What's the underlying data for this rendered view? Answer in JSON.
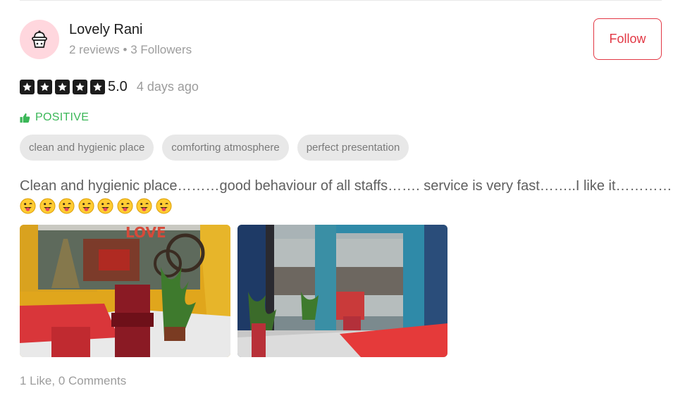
{
  "reviewer": {
    "name": "Lovely Rani",
    "reviews": "2 reviews",
    "separator": "•",
    "followers": "3 Followers",
    "avatar_icon": "cupcake-icon",
    "avatar_bg": "#ffd7de"
  },
  "follow_button": {
    "label": "Follow",
    "color": "#e23744"
  },
  "rating": {
    "stars": 5,
    "max_stars": 5,
    "value": "5.0",
    "time": "4 days ago"
  },
  "sentiment": {
    "icon": "thumbs-up-icon",
    "label": "POSITIVE",
    "color": "#3ab757"
  },
  "tags": [
    {
      "label": "clean and hygienic place"
    },
    {
      "label": "comforting atmosphere"
    },
    {
      "label": "perfect presentation"
    }
  ],
  "review": {
    "text": "Clean and hygienic place………good behaviour of all staffs……. service is very fast……..I like it…………",
    "emoji_count": 8,
    "emoji": "tongue-wink-emoji"
  },
  "photos": [
    {
      "description_icon": "restaurant-interior-photo"
    },
    {
      "description_icon": "restaurant-window-view-photo"
    }
  ],
  "footer": {
    "likes": "1 Like,",
    "comments": "0 Comments"
  }
}
